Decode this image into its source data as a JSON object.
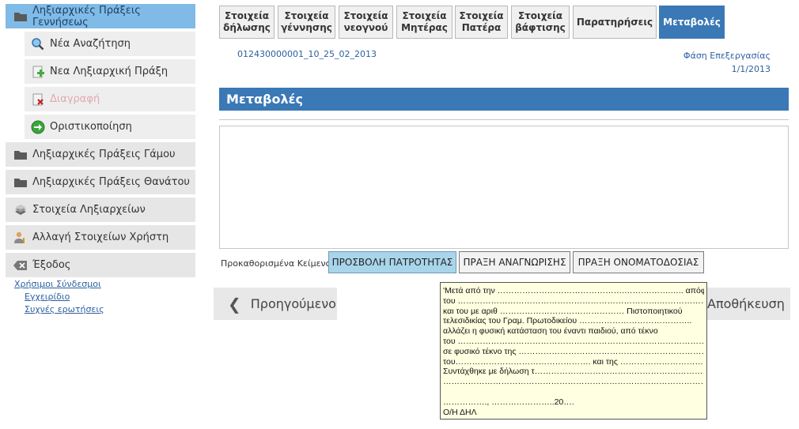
{
  "sidebar": {
    "births": "Ληξιαρχικές Πράξεις Γεννήσεως",
    "new_search": "Νέα Αναζήτηση",
    "new_act": "Νεα Ληξιαρχική Πράξη",
    "delete": "Διαγραφή",
    "finalize": "Οριστικοποίηση",
    "marriages": "Ληξιαρχικές Πράξεις Γάμου",
    "deaths": "Ληξιαρχικές Πράξεις Θανάτου",
    "registry_data": "Στοιχεία Ληξιαρχείων",
    "change_user": "Αλλαγή Στοιχείων Χρήστη",
    "exit": "Έξοδος"
  },
  "links": {
    "title": "Χρήσιμοι Σύνδεσμοι",
    "manual": "Εγχειρίδιο",
    "faq": "Συχνές ερωτήσεις"
  },
  "tabs": [
    {
      "l1": "Στοιχεία",
      "l2": "δήλωσης"
    },
    {
      "l1": "Στοιχεία",
      "l2": "γέννησης"
    },
    {
      "l1": "Στοιχεία",
      "l2": "νεογνού"
    },
    {
      "l1": "Στοιχεία",
      "l2": "Μητέρας"
    },
    {
      "l1": "Στοιχεία",
      "l2": "Πατέρα"
    },
    {
      "l1": "Στοιχεία",
      "l2": "βάφτισης"
    },
    {
      "l1": "Παρατηρήσεις",
      "l2": ""
    },
    {
      "l1": "Μεταβολές",
      "l2": ""
    }
  ],
  "record": {
    "code": "012430000001_10_25_02_2013",
    "phase_label": "Φάση Επεξεργασίας",
    "phase_date": "1/1/2013"
  },
  "section": {
    "title": "Μεταβολές"
  },
  "presets": {
    "label": "Προκαθορισμένα Κείμενα",
    "paternity": "ΠΡΟΣΒΟΛΗ ΠΑΤΡΟΤΗΤΑΣ",
    "recognition": "ΠΡΑΞΗ ΑΝΑΓΝΩΡΙΣΗΣ",
    "naming": "ΠΡΑΞΗ ΟΝΟΜΑΤΟΔΟΣΙΑΣ"
  },
  "nav_buttons": {
    "prev": "Προηγούμενο",
    "save": "Αποθήκευση"
  },
  "tooltip_lines": [
    "'Μετά από την ……………………………………….……….…….….. απόφαση",
    "του ……………………………………………………………….…………………….",
    "και του  με αριθ ……………………………………… Πιστοποιητικού",
    "τελεσιδικίας  του Γραμ. Πρωτοδικείου …………………………………..",
    "αλλάζει  η φυσική κατάσταση του έναντι  παιδιού, από τέκνο",
    "του …………………………………………………………………………………………..",
    "σε φυσικό τέκνο της …………………………………………………………………",
    "του…………………………………………. και της …………………………………….",
    "Συντάχθηκε με δήλωση τ…………………………………………….…………",
    "…………………………………………………………………………………………………….",
    "",
    "……………., …………………..20….",
    "Ο/Η  ΔΗΛ"
  ]
}
